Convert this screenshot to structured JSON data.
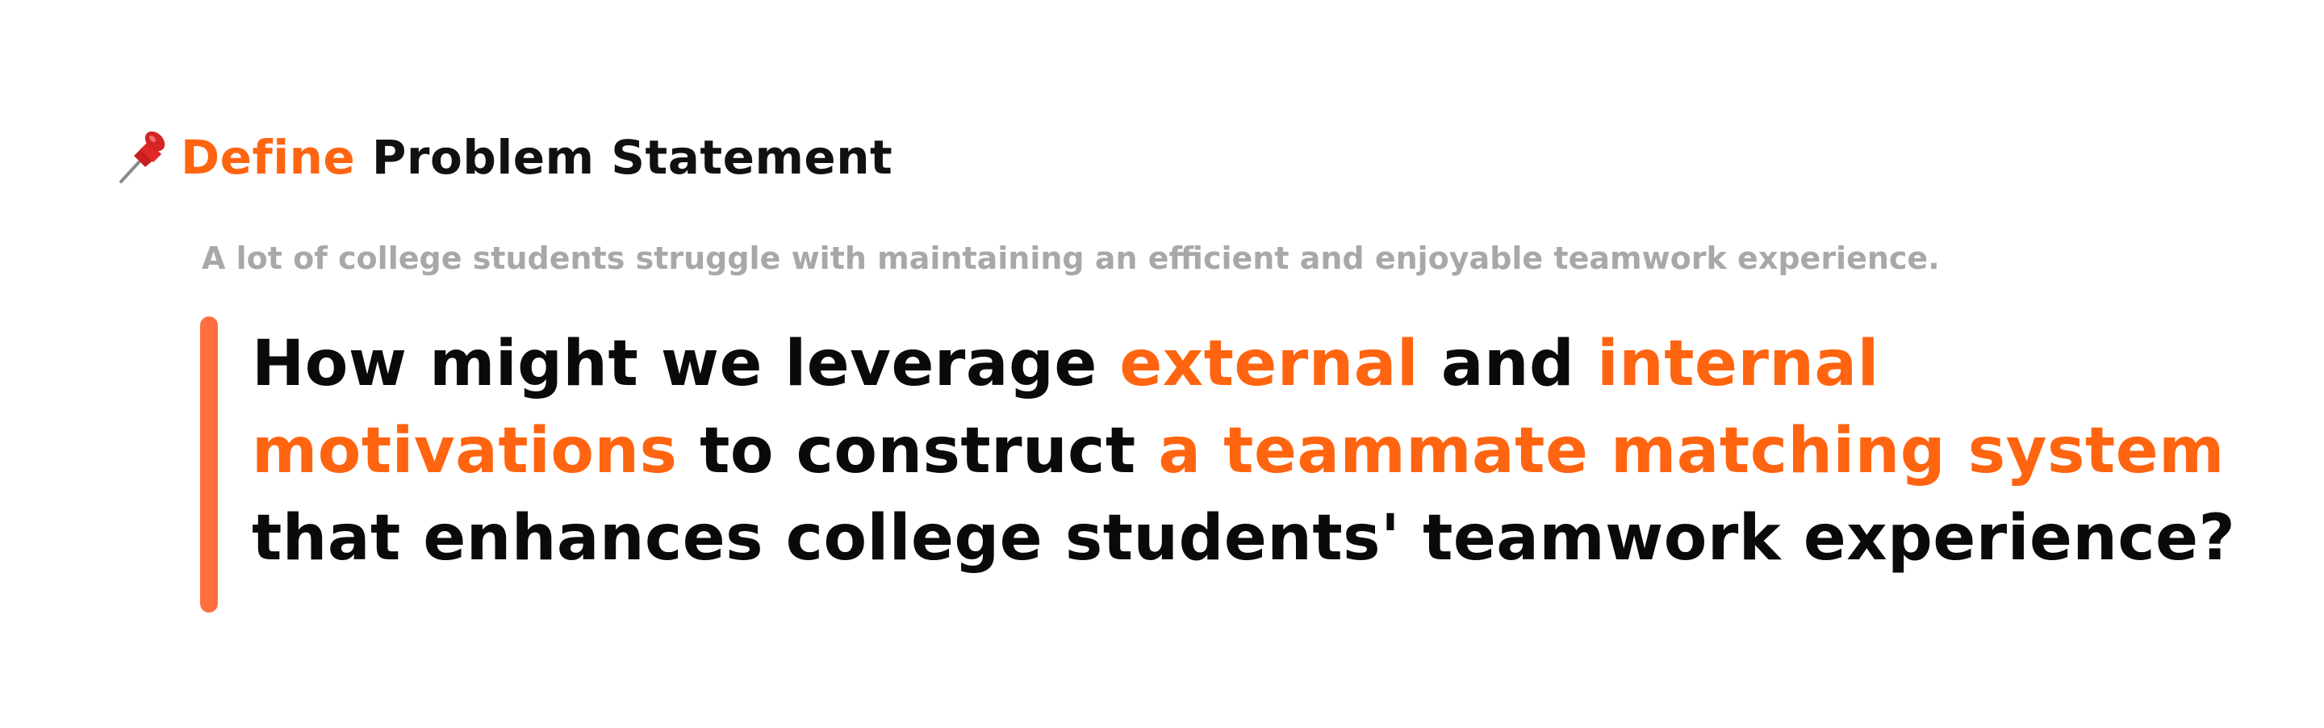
{
  "heading": {
    "icon": "pushpin-icon",
    "accent_word": "Define",
    "rest": " Problem Statement"
  },
  "subtitle": "A lot of college students struggle with maintaining an efficient and enjoyable teamwork experience.",
  "question": {
    "line1": {
      "p1": "How might we leverage ",
      "h1": "external",
      "p2": " and ",
      "h2": "internal"
    },
    "line2": {
      "h1": "motivations",
      "p1": " to construct ",
      "h2": "a teammate matching system"
    },
    "line3": {
      "p1": "that enhances college students' teamwork experience?"
    }
  },
  "colors": {
    "accent": "#ff6411",
    "bar": "#ff6f3f",
    "muted": "#a8a8a8",
    "text": "#0a0a0a"
  }
}
